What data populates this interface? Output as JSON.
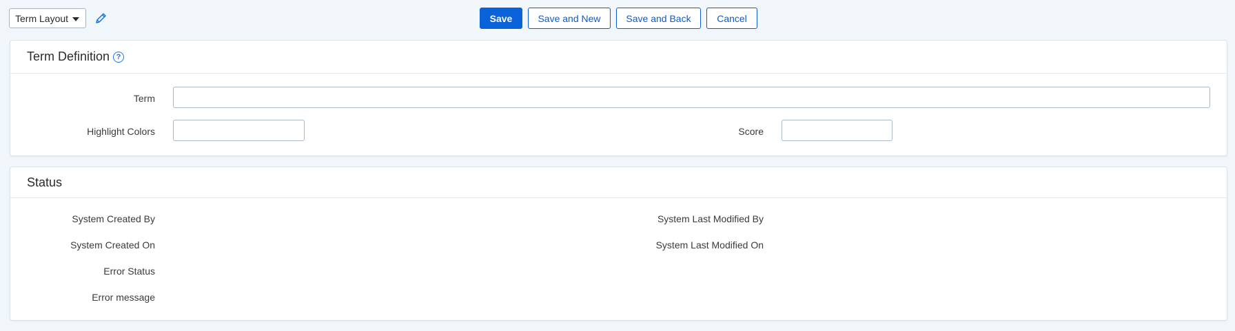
{
  "toolbar": {
    "layout_select": "Term Layout",
    "edit_icon": "pencil-icon",
    "save": "Save",
    "save_and_new": "Save and New",
    "save_and_back": "Save and Back",
    "cancel": "Cancel"
  },
  "term_definition": {
    "title": "Term Definition",
    "help_icon_glyph": "?",
    "term_label": "Term",
    "term_value": "",
    "highlight_label": "Highlight Colors",
    "highlight_value": "",
    "score_label": "Score",
    "score_value": ""
  },
  "status": {
    "title": "Status",
    "created_by_label": "System Created By",
    "created_on_label": "System Created On",
    "error_status_label": "Error Status",
    "error_message_label": "Error message",
    "last_modified_by_label": "System Last Modified By",
    "last_modified_on_label": "System Last Modified On"
  },
  "colors": {
    "primary": "#0a62d8",
    "background": "#f1f6fa"
  }
}
